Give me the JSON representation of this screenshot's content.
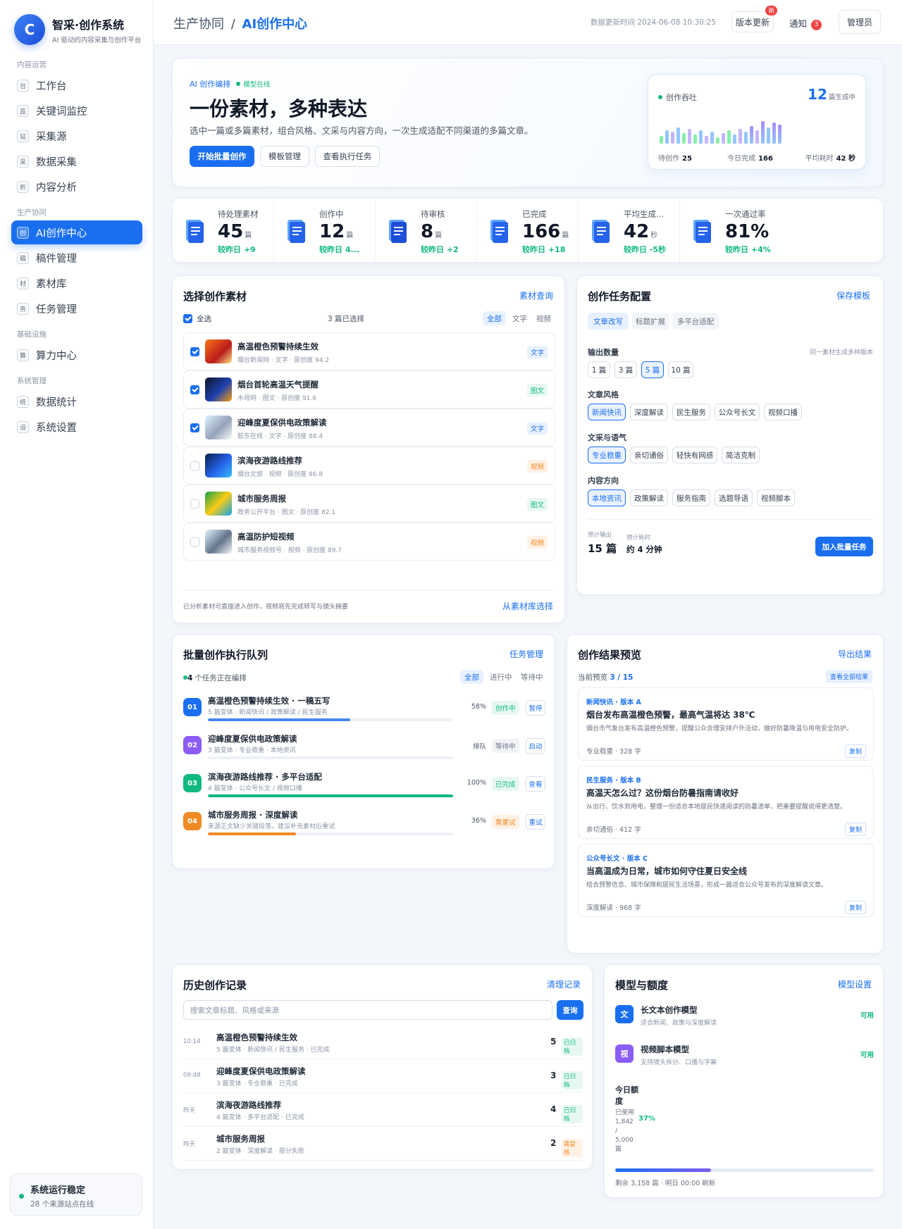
{
  "brand": {
    "logo": "C",
    "name": "智采·创作系统",
    "sub": "AI 驱动的内容采集与创作平台"
  },
  "sidebar": {
    "groups": [
      "内容运营",
      "生产协同",
      "基础设施",
      "系统管理"
    ],
    "items": [
      {
        "icon": "台",
        "label": "工作台"
      },
      {
        "icon": "监",
        "label": "关键词监控"
      },
      {
        "icon": "站",
        "label": "采集源"
      },
      {
        "icon": "采",
        "label": "数据采集"
      },
      {
        "icon": "析",
        "label": "内容分析"
      },
      {
        "icon": "创",
        "label": "AI创作中心"
      },
      {
        "icon": "稿",
        "label": "稿件管理"
      },
      {
        "icon": "材",
        "label": "素材库"
      },
      {
        "icon": "务",
        "label": "任务管理"
      },
      {
        "icon": "算",
        "label": "算力中心"
      },
      {
        "icon": "统",
        "label": "数据统计"
      },
      {
        "icon": "设",
        "label": "系统设置"
      }
    ],
    "status": {
      "title": "系统运行稳定",
      "sub": "28 个来源站点在线"
    }
  },
  "topbar": {
    "crumb_parent": "生产协同",
    "crumb_sep": "/",
    "crumb_current": "AI创作中心",
    "updated": "数据更新时间 2024-06-08 10:30:25",
    "version_btn": "版本更新",
    "version_badge": "新",
    "notice": "通知",
    "notice_count": "3",
    "admin": "管理员"
  },
  "hero": {
    "tag": "AI 创作编排",
    "online": "模型在线",
    "title": "一份素材，多种表达",
    "desc": "选中一篇或多篇素材，组合风格、文采与内容方向，一次生成适配不同渠道的多篇文章。",
    "btn_start": "开始批量创作",
    "btn_template": "模板管理",
    "btn_tasks": "查看执行任务",
    "throughput": {
      "label": "创作吞吐",
      "num": "12",
      "unit": "篇生成中",
      "bars": [
        0.3,
        0.5,
        0.45,
        0.6,
        0.4,
        0.55,
        0.35,
        0.5,
        0.3,
        0.45,
        0.25,
        0.4,
        0.5,
        0.35,
        0.55,
        0.45,
        0.65,
        0.5,
        0.85,
        0.6,
        0.8,
        0.7
      ],
      "foot": [
        {
          "label": "待创作",
          "value": "25"
        },
        {
          "label": "今日完成",
          "value": "166"
        },
        {
          "label": "平均耗时",
          "value": "42 秒"
        }
      ]
    }
  },
  "stats": [
    {
      "icon": "doc-stack-icon",
      "label": "待处理素材",
      "value": "45",
      "unit": "篇",
      "cmp": "较昨日 +9"
    },
    {
      "icon": "doc-search-icon",
      "label": "创作中",
      "value": "12",
      "unit": "篇",
      "cmp": "较昨日 4..."
    },
    {
      "icon": "doc-edit-icon",
      "label": "待审核",
      "value": "8",
      "unit": "篇",
      "cmp": "较昨日 +2"
    },
    {
      "icon": "doc-check-icon",
      "label": "已完成",
      "value": "166",
      "unit": "篇",
      "cmp": "较昨日 +18"
    },
    {
      "icon": "doc-plus-icon",
      "label": "平均生成...",
      "value": "42",
      "unit": "秒",
      "cmp": "较昨日 -5秒"
    },
    {
      "icon": "clipboard-check-icon",
      "label": "一次通过率",
      "value": "81%",
      "unit": "",
      "cmp": "较昨日 +4%"
    }
  ],
  "materials": {
    "title": "选择创作素材",
    "link": "素材查询",
    "select_all": "全选",
    "selected": "3 篇已选择",
    "filters": [
      "全部",
      "文字",
      "视频"
    ],
    "rows": [
      {
        "checked": true,
        "name": "高温橙色预警持续生效",
        "meta": "烟台新闻网 · 文字 · 原创度 94.2",
        "tag": "文字",
        "tone": "blue",
        "thumb": "linear-gradient(135deg,#f97316,#b91c1c 60%,#fde68a)"
      },
      {
        "checked": true,
        "name": "烟台首轮高温天气提醒",
        "meta": "水母网 · 图文 · 原创度 91.6",
        "tag": "图文",
        "tone": "green",
        "thumb": "linear-gradient(135deg,#0f172a,#1e40af 55%,#f59e0b)"
      },
      {
        "checked": true,
        "name": "迎峰度夏保供电政策解读",
        "meta": "胶东在线 · 文字 · 原创度 88.4",
        "tag": "文字",
        "tone": "blue",
        "thumb": "linear-gradient(135deg,#e0f2fe,#94a3b8 55%,#f8fafc)"
      },
      {
        "checked": false,
        "name": "滨海夜游路线推荐",
        "meta": "烟台文旅 · 视频 · 原创度 86.8",
        "tag": "视频",
        "tone": "orange",
        "thumb": "linear-gradient(135deg,#0b1e4a,#2563eb 55%,#38bdf8)"
      },
      {
        "checked": false,
        "name": "城市服务周报",
        "meta": "政务公开平台 · 图文 · 原创度 82.1",
        "tag": "图文",
        "tone": "green",
        "thumb": "linear-gradient(135deg,#16a34a,#facc15 50%,#0ea5e9)"
      },
      {
        "checked": false,
        "name": "高温防护短视频",
        "meta": "城市服务视频号 · 视频 · 原创度 89.7",
        "tag": "视频",
        "tone": "orange",
        "thumb": "linear-gradient(135deg,#e0f2fe,#64748b 55%,#f1f5f9)"
      }
    ],
    "footer": "已分析素材可直接进入创作，视频将先完成转写与镜头摘要",
    "footer_link": "从素材库选择"
  },
  "config": {
    "title": "创作任务配置",
    "link": "保存模板",
    "tabs": [
      "文章改写",
      "标题扩展",
      "多平台适配"
    ],
    "count_label": "输出数量",
    "count_hint": "同一素材生成多种版本",
    "counts": [
      "1 篇",
      "3 篇",
      "5 篇",
      "10 篇"
    ],
    "style_label": "文章风格",
    "styles": [
      "新闻快讯",
      "深度解读",
      "民生服务",
      "公众号长文",
      "视频口播"
    ],
    "tone_label": "文采与语气",
    "tones": [
      "专业稳重",
      "亲切通俗",
      "轻快有网感",
      "简洁克制"
    ],
    "dir_label": "内容方向",
    "dirs": [
      "本地资讯",
      "政策解读",
      "服务指南",
      "选题导语",
      "视频脚本"
    ],
    "est_out_label": "预计输出",
    "est_out": "15 篇",
    "est_time_label": "预计耗时",
    "est_time": "约 4 分钟",
    "submit": "加入批量任务"
  },
  "queue": {
    "title": "批量创作执行队列",
    "link": "任务管理",
    "count": "4",
    "count_text": "个任务正在编排",
    "filters": [
      "全部",
      "进行中",
      "等待中"
    ],
    "rows": [
      {
        "idx": "01",
        "color": "#1a6ff0",
        "name": "高温橙色预警持续生效 · 一稿五写",
        "meta": "5 篇变体 · 新闻快讯 / 政策解读 / 民生服务",
        "pct": "58%",
        "progress": 0.58,
        "bar": "#4a86f0",
        "status": "创作中",
        "st_bg": "#e7f8f1",
        "st_fg": "#10b981",
        "action": "暂停"
      },
      {
        "idx": "02",
        "color": "#8b5cf6",
        "name": "迎峰度夏保供电政策解读",
        "meta": "3 篇变体 · 专业稳重 · 本地资讯",
        "pct": "排队",
        "progress": 0,
        "bar": "#94a3b8",
        "status": "等待中",
        "st_bg": "#f1f3f7",
        "st_fg": "#6b7280",
        "action": "启动"
      },
      {
        "idx": "03",
        "color": "#10b981",
        "name": "滨海夜游路线推荐 · 多平台适配",
        "meta": "4 篇变体 · 公众号长文 / 视频口播",
        "pct": "100%",
        "progress": 1,
        "bar": "#10b981",
        "status": "已完成",
        "st_bg": "#e7f8f1",
        "st_fg": "#10b981",
        "action": "查看"
      },
      {
        "idx": "04",
        "color": "#f08a24",
        "name": "城市服务周报 · 深度解读",
        "meta": "来源正文缺少关键段落，建议补充素材后重试",
        "pct": "36%",
        "progress": 0.36,
        "bar": "#f08a24",
        "status": "需重试",
        "st_bg": "#fff1e4",
        "st_fg": "#f08a24",
        "action": "重试"
      }
    ]
  },
  "preview": {
    "title": "创作结果预览",
    "link": "导出结果",
    "current_label": "当前预览",
    "current": "3 / 15",
    "view_all": "查看全部结果",
    "copy": "复制",
    "cards": [
      {
        "tag": "新闻快讯 · 版本 A",
        "title": "烟台发布高温橙色预警，最高气温将达 38℃",
        "body": "烟台市气象台发布高温橙色预警，提醒公众合理安排户外活动，做好防暑降温与用电安全防护。",
        "foot": "专业稳重 · 328 字"
      },
      {
        "tag": "民生服务 · 版本 B",
        "title": "高温天怎么过？这份烟台防暑指南请收好",
        "body": "从出行、饮水到用电，整理一份适合本地居民快速阅读的防暑清单，把重要提醒说得更清楚。",
        "foot": "亲切通俗 · 412 字"
      },
      {
        "tag": "公众号长文 · 版本 C",
        "title": "当高温成为日常，城市如何守住夏日安全线",
        "body": "结合预警信息、城市保障和居民生活场景，形成一篇适合公众号发布的深度解读文章。",
        "foot": "深度解读 · 968 字"
      }
    ]
  },
  "history": {
    "title": "历史创作记录",
    "link": "清理记录",
    "placeholder": "搜索文章标题、风格或来源",
    "search_btn": "查询",
    "rows": [
      {
        "time": "10:14",
        "name": "高温橙色预警持续生效",
        "meta": "5 篇变体 · 新闻快讯 / 民生服务 · 已完成",
        "count": "5",
        "status": "已归档",
        "bg": "#e7f8f1",
        "fg": "#10b981"
      },
      {
        "time": "09:48",
        "name": "迎峰度夏保供电政策解读",
        "meta": "3 篇变体 · 专业稳重 · 已完成",
        "count": "3",
        "status": "已归档",
        "bg": "#e7f8f1",
        "fg": "#10b981"
      },
      {
        "time": "昨天",
        "name": "滨海夜游路线推荐",
        "meta": "4 篇变体 · 多平台适配 · 已完成",
        "count": "4",
        "status": "已归档",
        "bg": "#e7f8f1",
        "fg": "#10b981"
      },
      {
        "time": "昨天",
        "name": "城市服务周报",
        "meta": "2 篇变体 · 深度解读 · 部分失败",
        "count": "2",
        "status": "需复核",
        "bg": "#fff1e4",
        "fg": "#f08a24"
      }
    ]
  },
  "models": {
    "title": "模型与额度",
    "link": "模型设置",
    "items": [
      {
        "icon": "文",
        "color": "#1a6ff0",
        "name": "长文本创作模型",
        "sub": "适合新闻、政策与深度解读",
        "status": "可用"
      },
      {
        "icon": "视",
        "color": "#8b5cf6",
        "name": "视频脚本模型",
        "sub": "支持镜头拆分、口播与字幕",
        "status": "可用"
      }
    ],
    "quota_title": "今日额度",
    "quota_sub": "已使用 1,842 / 5,000 篇",
    "quota_pct": "37%",
    "quota_ratio": 0.37,
    "quota_foot": "剩余 3,158 篇 · 明日 00:00 刷新"
  }
}
